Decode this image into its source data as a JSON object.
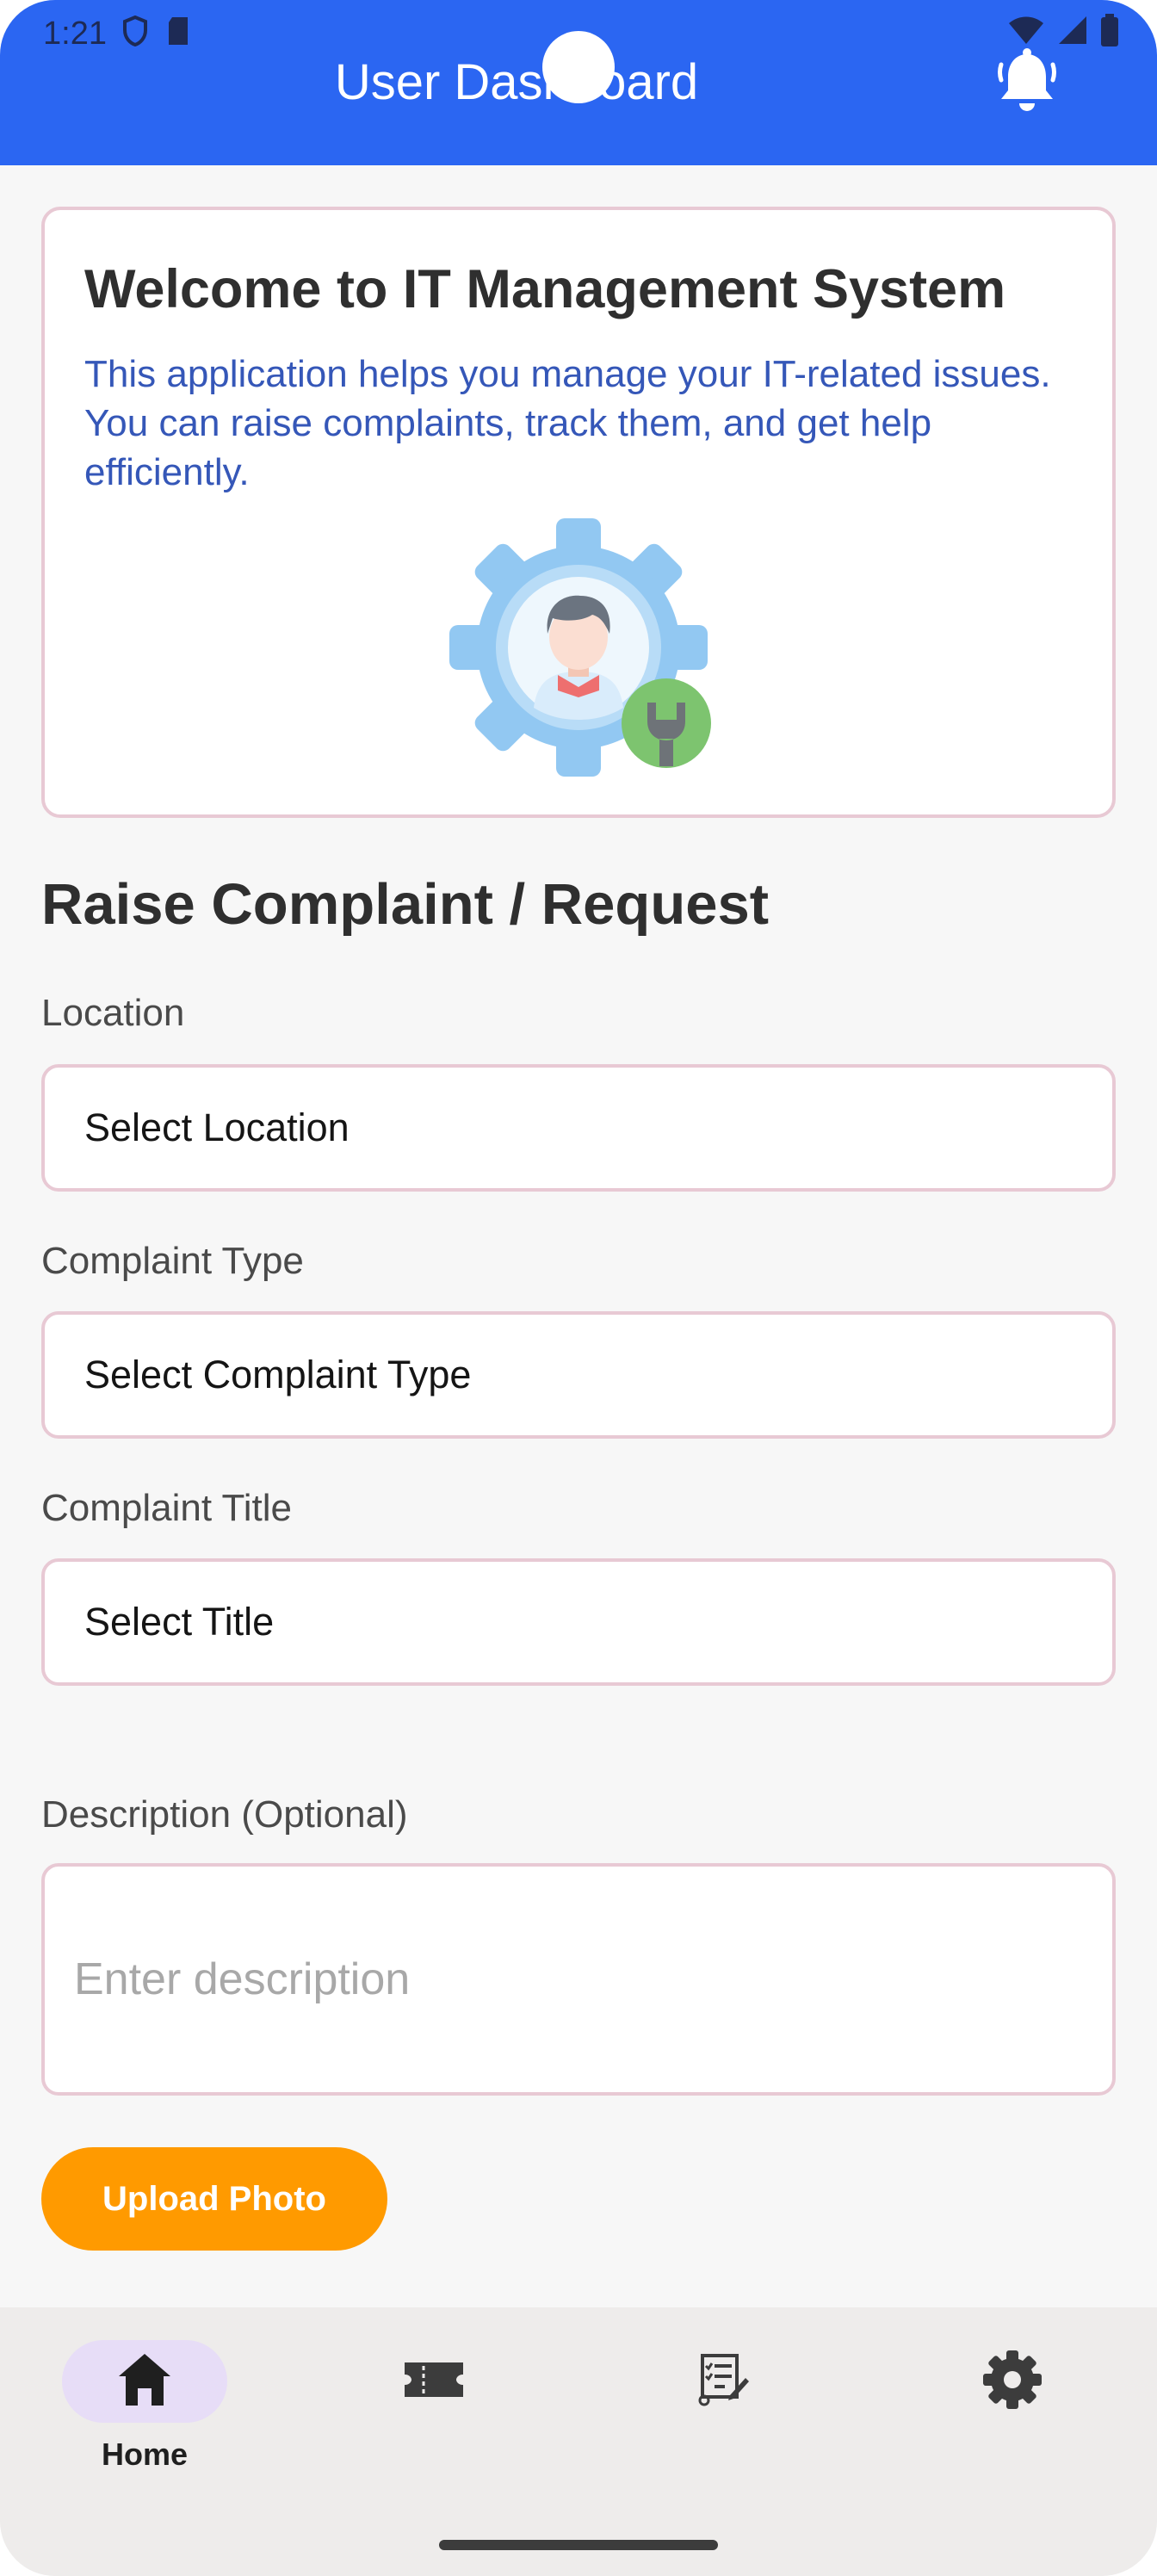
{
  "status_bar": {
    "time": "1:21",
    "left_icons": [
      "shield-icon",
      "sd-card-icon"
    ],
    "right_icons": [
      "wifi-icon",
      "signal-icon",
      "battery-icon"
    ]
  },
  "header": {
    "title": "User Dashboard",
    "background": "#2b66f2",
    "notification_icon": "bell-icon"
  },
  "welcome": {
    "title": "Welcome to IT Management System",
    "text": "This application helps you manage your IT-related issues. You can raise complaints, track them, and get help efficiently.",
    "illustration": "it-support-gear-icon"
  },
  "form": {
    "title": "Raise Complaint / Request",
    "location_label": "Location",
    "location_value": "Select Location",
    "type_label": "Complaint Type",
    "type_value": "Select Complaint Type",
    "title_label": "Complaint Title",
    "title_value": "Select Title",
    "description_label": "Description (Optional)",
    "description_placeholder": "Enter description",
    "upload_button": "Upload Photo",
    "upload_color": "#ff9a00"
  },
  "bottom_nav": {
    "items": [
      {
        "icon": "home-icon",
        "label": "Home",
        "active": true
      },
      {
        "icon": "ticket-icon",
        "label": "",
        "active": false
      },
      {
        "icon": "task-list-icon",
        "label": "",
        "active": false
      },
      {
        "icon": "settings-gear-icon",
        "label": "",
        "active": false
      }
    ]
  }
}
